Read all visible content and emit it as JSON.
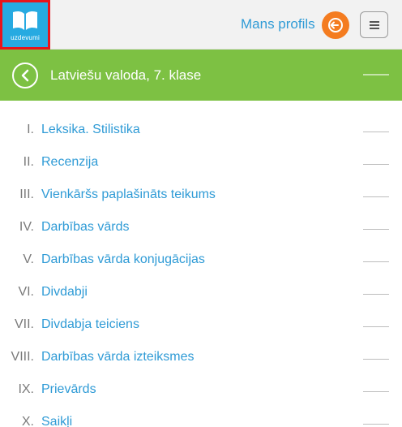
{
  "header": {
    "logo_text": "uzdevumi",
    "profile_link": "Mans profils",
    "logout_icon": "logout-icon",
    "menu_icon": "hamburger-icon"
  },
  "subject_bar": {
    "title": "Latviešu valoda, 7. klase",
    "back_icon": "chevron-left-icon"
  },
  "chapters": [
    {
      "num": "I.",
      "title": "Leksika. Stilistika"
    },
    {
      "num": "II.",
      "title": "Recenzija"
    },
    {
      "num": "III.",
      "title": "Vienkāršs paplašināts teikums"
    },
    {
      "num": "IV.",
      "title": "Darbības vārds"
    },
    {
      "num": "V.",
      "title": "Darbības vārda konjugācijas"
    },
    {
      "num": "VI.",
      "title": "Divdabji"
    },
    {
      "num": "VII.",
      "title": "Divdabja teiciens"
    },
    {
      "num": "VIII.",
      "title": "Darbības vārda izteiksmes"
    },
    {
      "num": "IX.",
      "title": "Prievārds"
    },
    {
      "num": "X.",
      "title": "Saikļi"
    }
  ],
  "colors": {
    "logo_bg": "#27aae1",
    "logo_border": "#e8141b",
    "accent_green": "#7dc143",
    "link_blue": "#2f9bd6",
    "logout_orange": "#f47c20"
  }
}
